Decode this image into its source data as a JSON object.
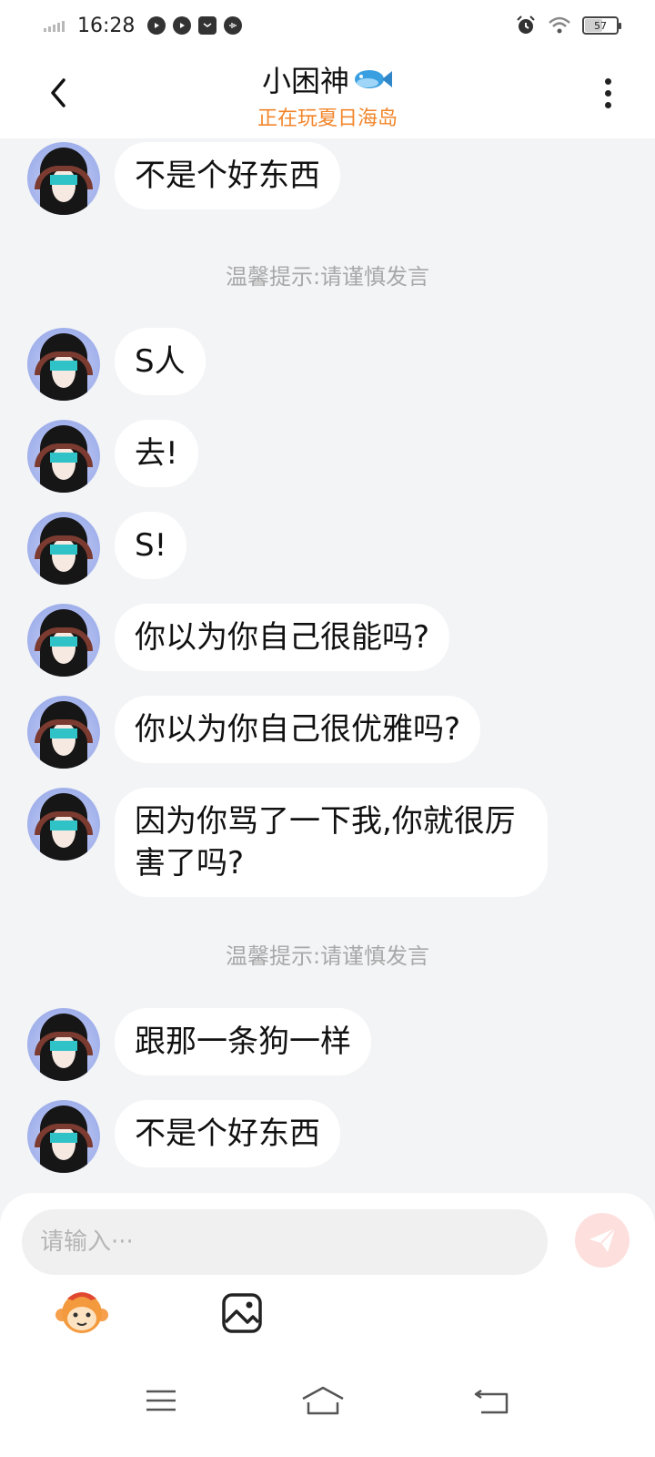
{
  "status_bar": {
    "time": "16:28",
    "battery": "57",
    "battery_level": 0.57
  },
  "header": {
    "title": "小困神",
    "subtitle": "正在玩夏日海岛",
    "title_icon": "fish-icon",
    "accent_color": "#f2862b"
  },
  "messages": [
    {
      "text": "不是个好东西"
    },
    {
      "text": "S人"
    },
    {
      "text": "去!"
    },
    {
      "text": "S!"
    },
    {
      "text": "你以为你自己很能吗?"
    },
    {
      "text": "你以为你自己很优雅吗?"
    },
    {
      "text": "因为你骂了一下我,你就很厉害了吗?"
    },
    {
      "text": "跟那一条狗一样"
    },
    {
      "text": "不是个好东西"
    }
  ],
  "notices": [
    "温馨提示:请谨慎发言",
    "温馨提示:请谨慎发言"
  ],
  "composer": {
    "placeholder": "请输入···"
  },
  "icons": {
    "back": "back-arrow-icon",
    "more": "more-vertical-icon",
    "send": "send-icon",
    "emoji": "monkey-emoji-icon",
    "image": "image-icon",
    "nav_menu": "menu-icon",
    "nav_home": "home-icon",
    "nav_back": "back-icon"
  }
}
